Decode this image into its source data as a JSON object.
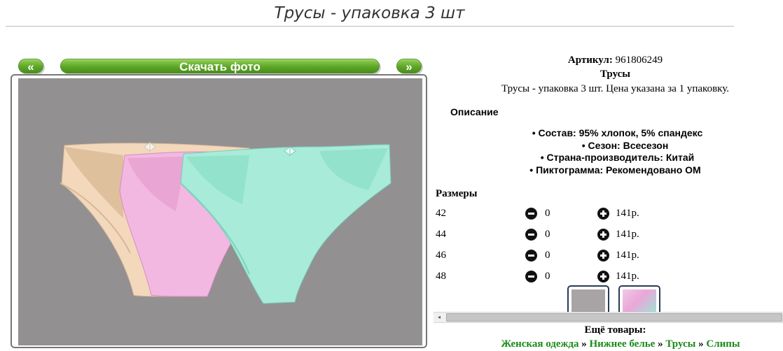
{
  "page": {
    "title": "Трусы - упаковка 3 шт"
  },
  "gallery": {
    "prev_label": "«",
    "next_label": "»",
    "download_label": "Скачать фото",
    "panty_colors": [
      "#f3d8bc",
      "#f2b8e2",
      "#a7ebd8"
    ]
  },
  "product": {
    "sku_label": "Артикул:",
    "sku_value": "961806249",
    "name": "Трусы",
    "description": "Трусы - упаковка 3 шт. Цена указана за 1 упаковку."
  },
  "specs": {
    "heading": "Описание",
    "items": [
      "Состав: 95% хлопок, 5% спандекс",
      "Сезон: Всесезон",
      "Страна-производитель: Китай",
      "Пиктограмма: Рекомендовано ОМ"
    ]
  },
  "sizes": {
    "heading": "Размеры",
    "rows": [
      {
        "size": "42",
        "qty": "0",
        "price": "141р."
      },
      {
        "size": "44",
        "qty": "0",
        "price": "141р."
      },
      {
        "size": "46",
        "qty": "0",
        "price": "141р."
      },
      {
        "size": "48",
        "qty": "0",
        "price": "141р."
      }
    ]
  },
  "scrollbar": {
    "left_arrow": "◂"
  },
  "more": {
    "heading": "Ещё товары:",
    "crumbs": [
      "Женская одежда",
      "Нижнее белье",
      "Трусы",
      "Слипы"
    ],
    "separator": " » "
  },
  "colors": {
    "accent_green": "#5da628",
    "link_green": "#1a8a1a",
    "photo_bg": "#939091"
  }
}
